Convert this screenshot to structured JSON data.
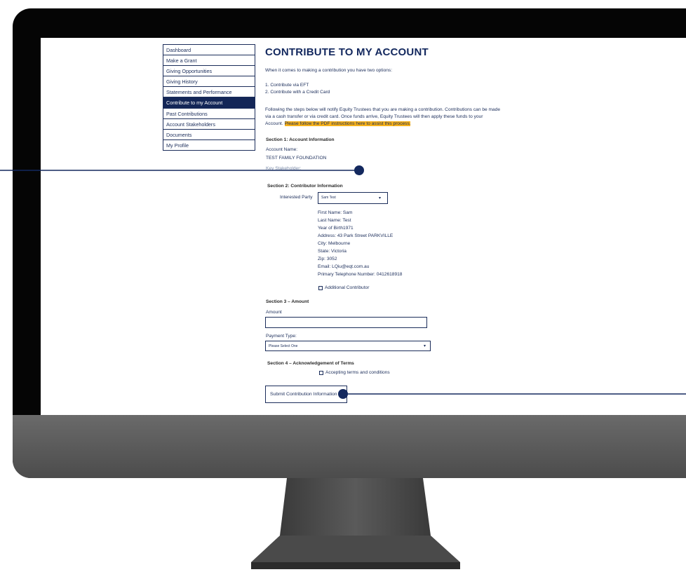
{
  "sidebar": {
    "items": [
      {
        "label": "Dashboard"
      },
      {
        "label": "Make a Grant"
      },
      {
        "label": "Giving Opportunities"
      },
      {
        "label": "Giving History"
      },
      {
        "label": "Statements and Performance"
      },
      {
        "label": "Contribute to my Account",
        "active": true
      },
      {
        "label": "Past Contributions"
      },
      {
        "label": "Account Stakeholders"
      },
      {
        "label": "Documents"
      },
      {
        "label": "My Profile"
      }
    ]
  },
  "page": {
    "title": "CONTRIBUTE TO MY ACCOUNT",
    "intro": "When it comes to making a contribution you have two options:",
    "option1": "1. Contribute via EFT",
    "option2": "2. Contribute with a Credit Card",
    "para_line1": "Following the steps below will notify Equity Trustees that you are making a contribution. Contributions can be made",
    "para_line2": "via a cash transfer or via credit card. Once funds arrive, Equity Trustees will then apply these funds to your",
    "para_line3": "Account.",
    "pdf_link": "Please follow the PDF instructions here to assist this process."
  },
  "section1": {
    "heading": "Section 1: Account Information",
    "account_name_label": "Account Name:",
    "account_name_value": "TEST FAMILY FOUNDATION",
    "key_stakeholder_label": "Key Stakeholder:"
  },
  "section2": {
    "heading": "Section 2: Contributor Information",
    "interested_party_label": "Interested Party",
    "interested_party_value": "Sam Test",
    "first_name": "First Name: Sam",
    "last_name": "Last Name: Test",
    "year_of_birth": "Year of Birth1971",
    "address": "Address: 43 Park Street PARKVILLE",
    "city": "City: Melbourne",
    "state": "State: Victoria",
    "zip": "Zip: 3052",
    "email": "Email: LQiu@eqt.com.au",
    "phone": "Primary Telephone Number: 0412618918",
    "additional_contributor": "Additional Contributor"
  },
  "section3": {
    "heading": "Section 3 – Amount",
    "amount_label": "Amount",
    "amount_value": "",
    "payment_type_label": "Payment Type:",
    "payment_type_value": "Please Select One"
  },
  "section4": {
    "heading": "Section 4 – Acknowledgement of Terms",
    "terms_label": "Accepting terms and conditions"
  },
  "submit_label": "Submit Contribution Information",
  "colors": {
    "navy": "#1b2d5a",
    "active_bg": "#132657",
    "highlight": "#f7b21b",
    "callout": "#13285e"
  }
}
